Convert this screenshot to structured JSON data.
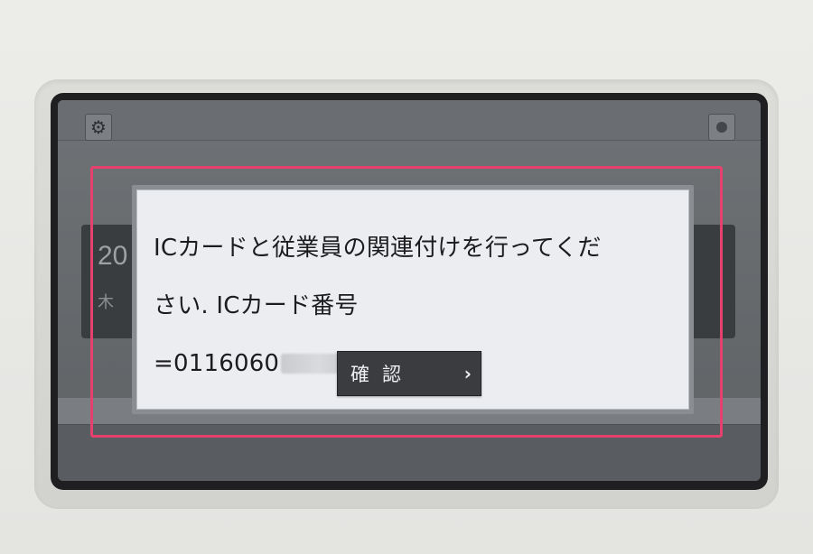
{
  "app": {
    "date_year_partial": "20",
    "weekday_partial": "木"
  },
  "dialog": {
    "message_line1": "ICカードと従業員の関連付けを行ってくだ",
    "message_line2": "さい. ICカード番号",
    "card_number_visible": "=0116060",
    "card_number_redacted": true,
    "confirm_label": "確認",
    "confirm_chevron": "›"
  },
  "icons": {
    "settings": "gear-icon",
    "power": "power-icon",
    "chevron": "chevron-right-icon"
  },
  "colors": {
    "highlight": "#e6416e",
    "dialog_bg": "#ebedf0",
    "button_bg": "#3a3c40"
  }
}
